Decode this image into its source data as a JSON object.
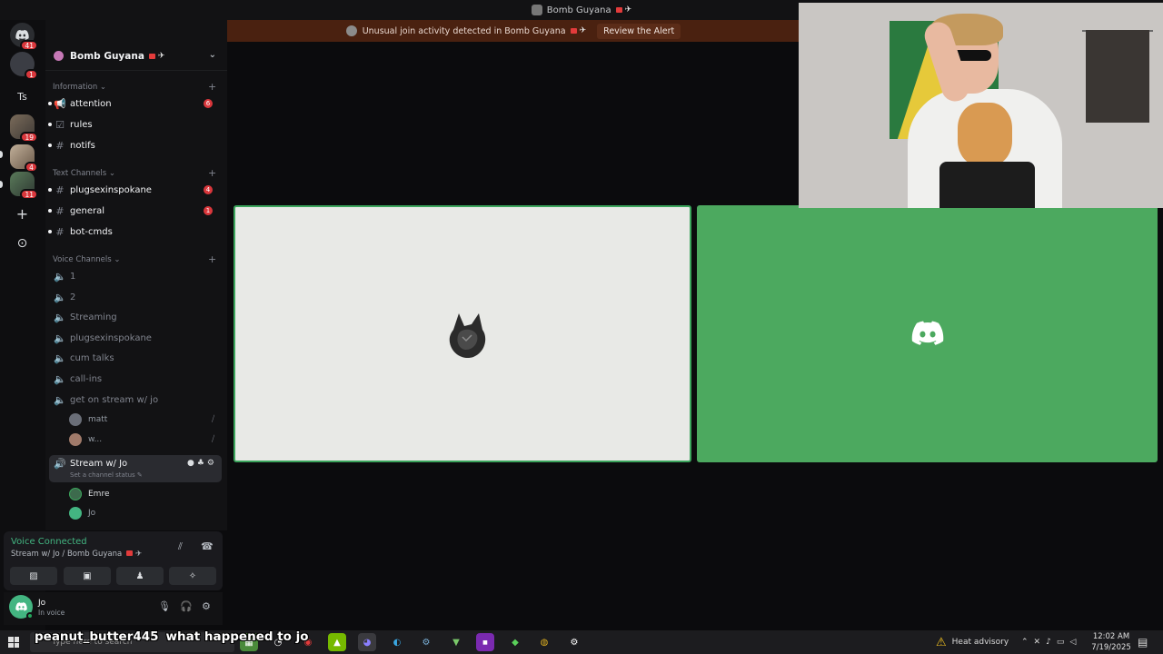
{
  "window": {
    "title": "Bomb Guyana",
    "title_suffix": "✈"
  },
  "alert": {
    "text": "Unusual join activity detected in Bomb Guyana",
    "suffix": "✈",
    "action_label": "Review the Alert"
  },
  "rail": {
    "servers": [
      {
        "icon": "discord-icon",
        "badge": "41"
      },
      {
        "icon": "avatar",
        "badge": "1"
      },
      {
        "label": "Ts",
        "badge": ""
      },
      {
        "icon": "avatar",
        "badge": "19"
      },
      {
        "icon": "avatar",
        "badge": "4"
      },
      {
        "icon": "avatar",
        "badge": "11"
      }
    ],
    "add_label": "+",
    "explore_label": "⊙"
  },
  "server": {
    "name": "Bomb Guyana",
    "suffix": "✈"
  },
  "categories": {
    "information": "Information",
    "text": "Text Channels",
    "voice": "Voice Channels"
  },
  "info_channels": [
    {
      "name": "attention",
      "count": "6"
    },
    {
      "name": "rules",
      "count": ""
    },
    {
      "name": "notifs",
      "count": ""
    }
  ],
  "text_channels": [
    {
      "name": "plugsexinspokane",
      "count": "4"
    },
    {
      "name": "general",
      "count": "1"
    },
    {
      "name": "bot-cmds",
      "count": ""
    }
  ],
  "voice_channels": [
    {
      "name": "1"
    },
    {
      "name": "2"
    },
    {
      "name": "Streaming"
    },
    {
      "name": "plugsexinspokane"
    },
    {
      "name": "cum talks"
    },
    {
      "name": "call-ins"
    },
    {
      "name": "get on stream w/ jo"
    }
  ],
  "stream_vc_users": [
    {
      "name": "matt"
    },
    {
      "name": "w..."
    }
  ],
  "active_channel": {
    "name": "Stream w/ Jo",
    "status_hint": "Set a channel status ✎"
  },
  "active_users": [
    {
      "name": "Emre"
    },
    {
      "name": "Jo"
    }
  ],
  "voice_panel": {
    "status": "Voice Connected",
    "location": "Stream w/ Jo / Bomb Guyana",
    "location_suffix": "✈"
  },
  "user": {
    "name": "Jo",
    "status": "In voice"
  },
  "taskbar": {
    "search_placeholder": "Type here to search",
    "chat_user": "peanut_butter445",
    "chat_message": "what happened to jo",
    "weather": "Heat advisory",
    "time": "12:02 AM",
    "date": "7/19/2025"
  },
  "colors": {
    "accent_green": "#3ba55c",
    "discord_green": "#4ca95f",
    "alert_bg": "#4a2110",
    "badge_red": "#da373c"
  }
}
